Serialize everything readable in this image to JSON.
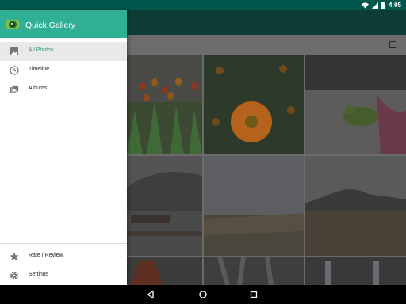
{
  "status_bar": {
    "time": "4:05",
    "icons": [
      "wifi-icon",
      "signal-icon",
      "battery-icon"
    ]
  },
  "drawer": {
    "app_title": "Quick Gallery",
    "app_logo_icon": "camera-lens-icon",
    "items": [
      {
        "label": "All Photos",
        "icon": "image-icon",
        "active": true
      },
      {
        "label": "Timeline",
        "icon": "clock-icon",
        "active": false
      },
      {
        "label": "Albums",
        "icon": "albums-icon",
        "active": false
      }
    ],
    "bottom_items": [
      {
        "label": "Rate / Review",
        "icon": "star-icon"
      },
      {
        "label": "Settings",
        "icon": "gear-icon"
      }
    ]
  },
  "photos": [
    {
      "subject": "tulips"
    },
    {
      "subject": "orange flower"
    },
    {
      "subject": "green frog"
    },
    {
      "subject": "harbor with boat"
    },
    {
      "subject": "misty field"
    },
    {
      "subject": "volcano landscape"
    },
    {
      "subject": "pagoda"
    },
    {
      "subject": "waterfall"
    },
    {
      "subject": "towers"
    }
  ],
  "navigation_bar": {
    "buttons": [
      "back-icon",
      "home-icon",
      "recents-icon"
    ]
  },
  "colors": {
    "status_bar": "#00574b",
    "drawer_header": "#2fb094",
    "active_label": "#2a9d86",
    "active_bg": "#e9e9e9"
  }
}
